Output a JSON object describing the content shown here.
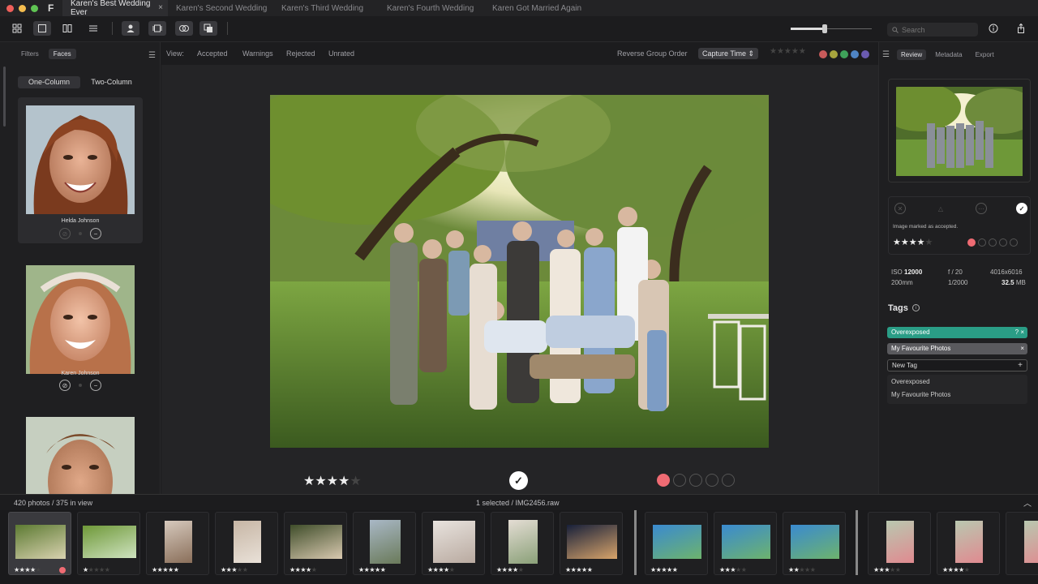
{
  "window": {
    "tabs": [
      {
        "label": "Karen's Best Wedding Ever",
        "active": true
      },
      {
        "label": "Karen's Second Wedding",
        "active": false
      },
      {
        "label": "Karen's Third Wedding",
        "active": false
      },
      {
        "label": "Karen's Fourth Wedding",
        "active": false
      },
      {
        "label": "Karen Got Married Again",
        "active": false
      }
    ],
    "tab_close": "×",
    "app_icon": "F"
  },
  "toolbar": {
    "search_placeholder": "Search",
    "zoom_level": 0.42
  },
  "sidebar": {
    "tabs": [
      "Filters",
      "Faces"
    ],
    "active_tab": "Faces",
    "layout_tabs": [
      "One-Column",
      "Two-Column"
    ],
    "faces": [
      {
        "name": "Helda Johnson",
        "selected": true
      },
      {
        "name": "Karen Johnson",
        "selected": false
      },
      {
        "name": ""
      }
    ]
  },
  "viewbar": {
    "label": "View:",
    "filters": [
      "Accepted",
      "Warnings",
      "Rejected",
      "Unrated"
    ],
    "reverse_group": "Reverse Group Order",
    "sort_select": "Capture Time",
    "stars": "★★★★★",
    "color_labels": [
      "#c75a5a",
      "#a6a33d",
      "#3fa25a",
      "#4f84c4",
      "#6b5bb0"
    ]
  },
  "viewer": {
    "rating": 4,
    "max_rating": 5,
    "accepted": true,
    "check_glyph": "✓",
    "color_label": "#ef6b73"
  },
  "right_panel": {
    "tabs": [
      "Review",
      "Metadata",
      "Export"
    ],
    "active_tab": "Review",
    "review_message": "Image marked as accepted.",
    "rating": 4,
    "exif": {
      "iso_label": "ISO",
      "iso_value": "12000",
      "aperture": "f / 20",
      "dimensions": "4016x6016",
      "focal": "200mm",
      "shutter": "1/2000",
      "size_value": "32.5",
      "size_unit": "MB"
    },
    "tags_title": "Tags",
    "tags": [
      {
        "label": "Overexposed",
        "color": "#2a9d86",
        "suffix": "? ×"
      },
      {
        "label": "My Favourite Photos",
        "color": "#5a5a5e",
        "suffix": "×"
      }
    ],
    "new_tag_value": "New Tag",
    "suggestions": [
      "Overexposed",
      "My Favourite Photos"
    ]
  },
  "filmstrip": {
    "count_text": "420 photos / 375 in view",
    "selection_text": "1 selected / IMG2456.raw",
    "items": [
      {
        "stars": 4,
        "selected": true,
        "color_dot": true
      },
      {
        "stars": 1
      },
      {
        "stars": 5
      },
      {
        "stars": 3
      },
      {
        "stars": 4
      },
      {
        "stars": 5
      },
      {
        "stars": 4
      },
      {
        "stars": 4
      },
      {
        "stars": 5
      },
      {
        "stars": 5
      },
      {
        "stars": 3
      },
      {
        "stars": 2
      },
      {
        "stars": 3
      },
      {
        "stars": 4
      },
      {
        "stars": 0
      }
    ]
  }
}
